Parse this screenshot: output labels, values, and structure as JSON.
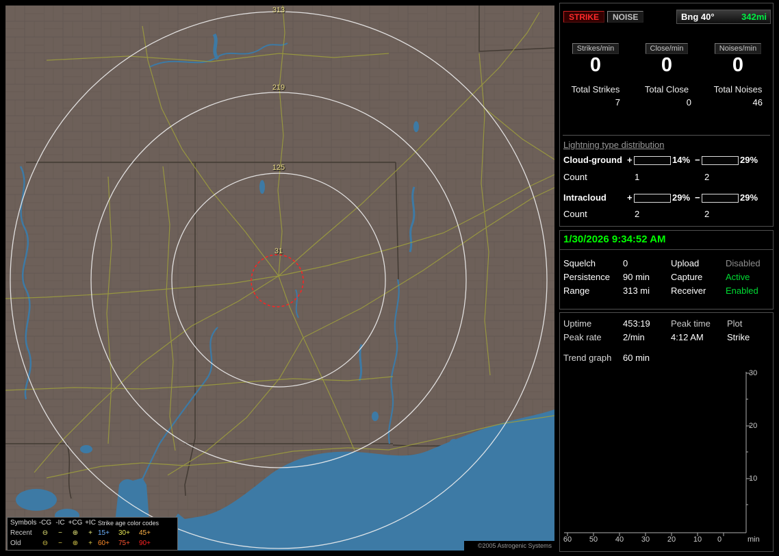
{
  "colors": {
    "accent_green": "#00ff00",
    "strike_red": "#ff2a2a",
    "ring_label_yellow": "#efe08a",
    "water_blue": "#3d7aa5",
    "land_brown": "#6d6059",
    "road_yellow": "#9c9c3e"
  },
  "map": {
    "ring_labels": [
      "313",
      "219",
      "125",
      "31"
    ],
    "copyright": "©2005 Astrogenic Systems",
    "legend": {
      "symbols_header": "Symbols",
      "col_headers": [
        "-CG",
        "-IC",
        "+CG",
        "+IC"
      ],
      "age_header": "Strike age color codes",
      "rows": [
        {
          "label": "Recent",
          "symbol_color": "#e8e87a",
          "symbols": [
            "⊖",
            "−",
            "⊕",
            "+"
          ],
          "ages": [
            {
              "text": "15+",
              "color": "#6db2ff"
            },
            {
              "text": "30+",
              "color": "#e8e855"
            },
            {
              "text": "45+",
              "color": "#ffb347"
            }
          ]
        },
        {
          "label": "Old",
          "symbol_color": "#d8c84a",
          "symbols": [
            "⊖",
            "−",
            "⊕",
            "+"
          ],
          "ages": [
            {
              "text": "60+",
              "color": "#ff8c2a"
            },
            {
              "text": "75+",
              "color": "#ff5533"
            },
            {
              "text": "90+",
              "color": "#ff2222"
            }
          ]
        }
      ]
    }
  },
  "panel": {
    "strike_button": "STRIKE",
    "noise_button": "NOISE",
    "bearing_label": "Bng 40°",
    "bearing_value": "342mi",
    "counters": [
      {
        "label": "Strikes/min",
        "value": "0",
        "total_label": "Total Strikes",
        "total_value": "7"
      },
      {
        "label": "Close/min",
        "value": "0",
        "total_label": "Total Close",
        "total_value": "0"
      },
      {
        "label": "Noises/min",
        "value": "0",
        "total_label": "Total Noises",
        "total_value": "46"
      }
    ],
    "distribution": {
      "title": "Lightning type distribution",
      "plus_sign": "+",
      "minus_sign": "−",
      "rows": [
        {
          "label": "Cloud-ground",
          "plus_pct": "14%",
          "plus_fill": 45,
          "plus_color": "#ff1111",
          "minus_pct": "29%",
          "minus_fill": 72,
          "minus_color": "#6aa6ff",
          "count_label": "Count",
          "plus_count": "1",
          "minus_count": "2"
        },
        {
          "label": "Intracloud",
          "plus_pct": "29%",
          "plus_fill": 60,
          "plus_color": "#ff6ed0",
          "minus_pct": "29%",
          "minus_fill": 88,
          "minus_color": "#2ae24a",
          "count_label": "Count",
          "plus_count": "2",
          "minus_count": "2"
        }
      ]
    },
    "status": {
      "datetime": "1/30/2026 9:34:52 AM",
      "rows": [
        {
          "l1": "Squelch",
          "v1": "0",
          "l2": "Upload",
          "v2": "Disabled",
          "v2_color": "#8f8f8f"
        },
        {
          "l1": "Persistence",
          "v1": "90 min",
          "l2": "Capture",
          "v2": "Active",
          "v2_color": "#00dd33"
        },
        {
          "l1": "Range",
          "v1": "313 mi",
          "l2": "Receiver",
          "v2": "Enabled",
          "v2_color": "#00dd33"
        }
      ]
    },
    "stats": {
      "rows": [
        {
          "l": "Uptime",
          "v": "453:19",
          "c3": "Peak time",
          "c4": "Plot"
        },
        {
          "l": "Peak rate",
          "v": "2/min",
          "c3": "4:12 AM",
          "c4": "Strike"
        }
      ],
      "trend_label": "Trend graph",
      "trend_value": "60 min"
    },
    "trend_graph": {
      "y_ticks": [
        "30",
        "20",
        "10"
      ],
      "x_ticks": [
        "60",
        "50",
        "40",
        "30",
        "20",
        "10",
        "0"
      ],
      "unit": "min"
    }
  }
}
